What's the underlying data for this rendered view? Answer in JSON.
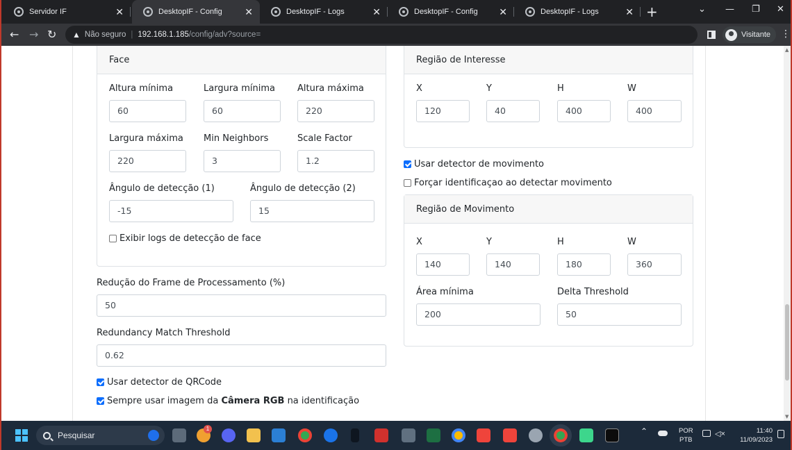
{
  "browser": {
    "tabs": [
      {
        "title": "Servidor IF",
        "active": false
      },
      {
        "title": "DesktopIF - Config",
        "active": true
      },
      {
        "title": "DesktopIF - Logs",
        "active": false
      },
      {
        "title": "DesktopIF - Config",
        "active": false
      },
      {
        "title": "DesktopIF - Logs",
        "active": false
      }
    ],
    "close_glyph": "✕",
    "new_tab_glyph": "+",
    "tab_search_glyph": "⌄",
    "minimize_glyph": "—",
    "restore_glyph": "❐",
    "close_window_glyph": "✕",
    "back_glyph": "←",
    "forward_glyph": "→",
    "reload_glyph": "↻",
    "warning_glyph": "▲",
    "security_label": "Não seguro",
    "url_host": "192.168.1.185",
    "url_path": "/config/adv?source=",
    "profile_label": "Visitante",
    "menu_glyph": "⋮"
  },
  "face": {
    "header": "Face",
    "altura_minima_label": "Altura mínima",
    "altura_minima": "60",
    "largura_minima_label": "Largura mínima",
    "largura_minima": "60",
    "altura_maxima_label": "Altura máxima",
    "altura_maxima": "220",
    "largura_maxima_label": "Largura máxima",
    "largura_maxima": "220",
    "min_neighbors_label": "Min Neighbors",
    "min_neighbors": "3",
    "scale_factor_label": "Scale Factor",
    "scale_factor": "1.2",
    "angulo1_label": "Ângulo de detecção (1)",
    "angulo1": "-15",
    "angulo2_label": "Ângulo de detecção (2)",
    "angulo2": "15",
    "exibir_logs_label": "Exibir logs de detecção de face",
    "exibir_logs_checked": false
  },
  "processing": {
    "reducao_label": "Redução do Frame de Processamento (%)",
    "reducao": "50",
    "redundancy_label": "Redundancy Match Threshold",
    "redundancy": "0.62",
    "qrcode_label": "Usar detector de QRCode",
    "qrcode_checked": true,
    "rgb_label_prefix": "Sempre usar imagem da ",
    "rgb_label_bold": "Câmera RGB",
    "rgb_label_suffix": " na identificação",
    "rgb_checked": true
  },
  "regiao_interesse": {
    "header": "Região de Interesse",
    "x_label": "X",
    "x": "120",
    "y_label": "Y",
    "y": "40",
    "h_label": "H",
    "h": "400",
    "w_label": "W",
    "w": "400"
  },
  "movement": {
    "usar_detector_label": "Usar detector de movimento",
    "usar_detector_checked": true,
    "forcar_label": "Forçar identificaçao ao detectar movimento",
    "forcar_checked": false
  },
  "regiao_movimento": {
    "header": "Região de Movimento",
    "x_label": "X",
    "x": "140",
    "y_label": "Y",
    "y": "140",
    "h_label": "H",
    "h": "180",
    "w_label": "W",
    "w": "360",
    "area_minima_label": "Área mínima",
    "area_minima": "200",
    "delta_label": "Delta Threshold",
    "delta": "50"
  },
  "taskbar": {
    "search_label": "Pesquisar",
    "notification_badge": "1",
    "tray_chevron": "⌃",
    "lang_line1": "POR",
    "lang_line2": "PTB",
    "time": "11:40",
    "date": "11/09/2023",
    "icons": [
      "widgets-icon",
      "task-view-icon",
      "chrome-canary-icon",
      "discord-icon",
      "file-explorer-icon",
      "snipping-tool-icon",
      "chrome-icon",
      "teamviewer-icon",
      "phone-icon",
      "evo-icon",
      "calculator-icon",
      "excel-icon",
      "chrome-dev-icon",
      "anydesk-icon",
      "anydesk-alt-icon",
      "settings-icon",
      "chrome-active-icon",
      "power-automate-icon",
      "terminal-icon"
    ],
    "colors": {
      "taskbar": "#1c2a3a",
      "accent": "#4cc2ff"
    }
  },
  "colors": {
    "checkbox_checked": "#0d6efd",
    "card_header_bg": "#f7f7f7",
    "input_border": "#ced4da",
    "window_border": "#c0392b"
  }
}
